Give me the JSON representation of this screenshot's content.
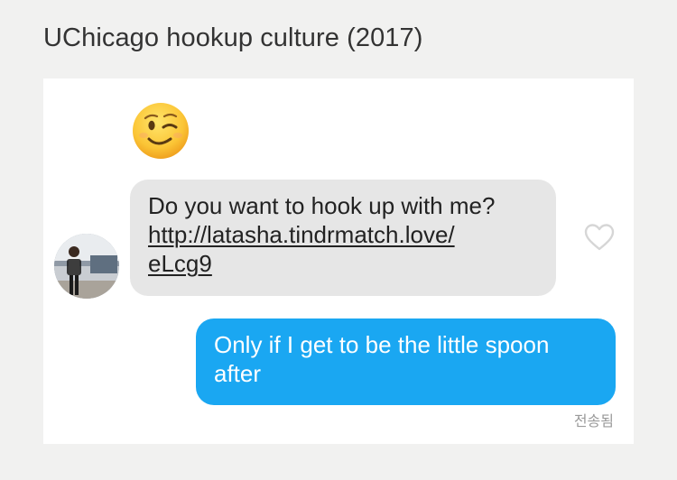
{
  "page": {
    "title": "UChicago hookup culture (2017)"
  },
  "chat": {
    "reaction_emoji": "winking-face",
    "incoming": {
      "line1": "Do you want to hook up with me?",
      "link_line1": "http://latasha.tindrmatch.love/",
      "link_line2": "eLcg9"
    },
    "outgoing": {
      "line1": "Only if I get to be the little spoon",
      "line2": "after"
    },
    "status": "전송됨"
  },
  "colors": {
    "background": "#f1f1f0",
    "incoming_bubble": "#e6e6e6",
    "outgoing_bubble": "#1aa7f2",
    "status_text": "#9a9a9a"
  },
  "icons": [
    "winking-face-emoji",
    "heart-outline-icon",
    "avatar-photo"
  ]
}
